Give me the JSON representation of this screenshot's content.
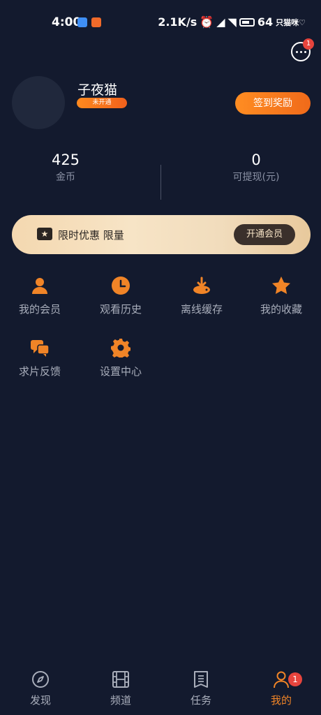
{
  "status_bar": {
    "time": "4:00",
    "network_speed": "2.1K/s",
    "battery": "64",
    "carrier": "只猫咪♡"
  },
  "header": {
    "more_badge": "1"
  },
  "profile": {
    "username": "子夜猫",
    "vip_status": "未开通",
    "checkin_label": "签到奖励"
  },
  "stats": [
    {
      "value": "425",
      "label": "金币"
    },
    {
      "value": "0",
      "label": "可提现(元)"
    }
  ],
  "vip_banner": {
    "text": "限时优惠 限量",
    "button": "开通会员"
  },
  "menu": [
    {
      "label": "我的会员",
      "icon": "person-icon"
    },
    {
      "label": "观看历史",
      "icon": "clock-icon"
    },
    {
      "label": "离线缓存",
      "icon": "download-icon"
    },
    {
      "label": "我的收藏",
      "icon": "star-icon"
    },
    {
      "label": "求片反馈",
      "icon": "chat-icon"
    },
    {
      "label": "设置中心",
      "icon": "gear-icon"
    }
  ],
  "bottom_nav": [
    {
      "label": "发现",
      "icon": "compass-icon"
    },
    {
      "label": "频道",
      "icon": "film-icon"
    },
    {
      "label": "任务",
      "icon": "task-icon"
    },
    {
      "label": "我的",
      "icon": "user-icon",
      "badge": "1",
      "active": true
    }
  ],
  "colors": {
    "background": "#131a2e",
    "accent": "#f08427",
    "badge": "#e6443d"
  }
}
